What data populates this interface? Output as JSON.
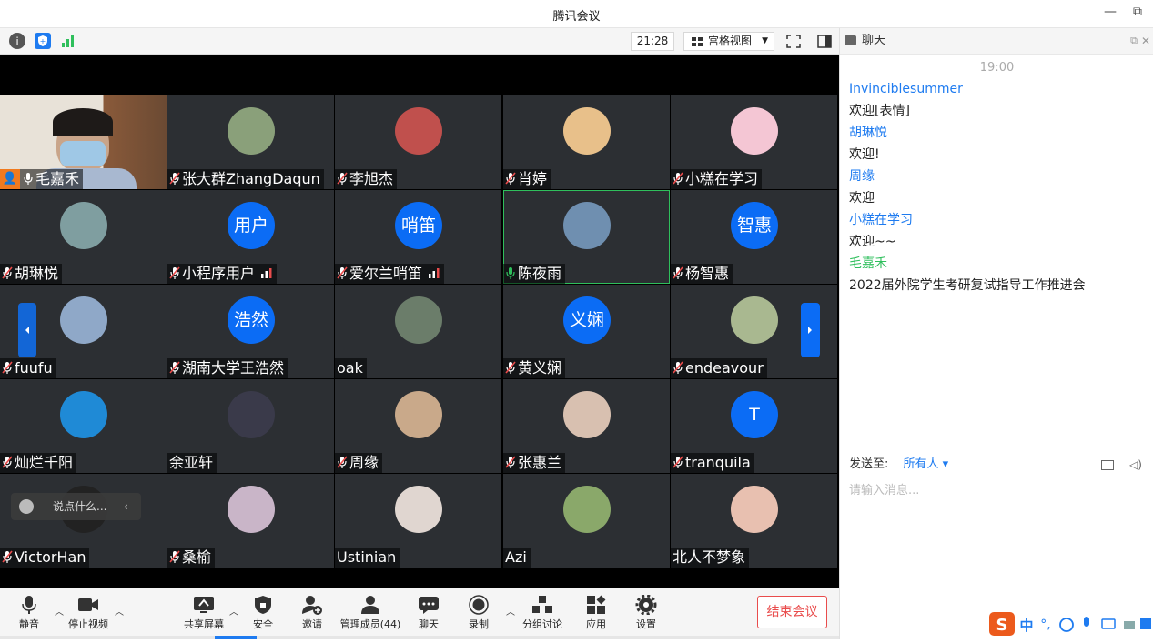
{
  "window": {
    "title": "腾讯会议",
    "minimize_glyph": "—",
    "restore_glyph": "⧉"
  },
  "topbar": {
    "time": "21:28",
    "view_label": "宫格视图"
  },
  "tiles": [
    {
      "name": "毛嘉禾",
      "avatar_text": "",
      "avatar_color": "#7a8a90",
      "video": true
    },
    {
      "name": "张大群ZhangDaqun",
      "avatar_text": "",
      "avatar_color": "#8aa07a"
    },
    {
      "name": "李旭杰",
      "avatar_text": "",
      "avatar_color": "#c0504d"
    },
    {
      "name": "肖婷",
      "avatar_text": "",
      "avatar_color": "#e8c08a"
    },
    {
      "name": "小糕在学习",
      "avatar_text": "",
      "avatar_color": "#f4c6d4"
    },
    {
      "name": "胡琳悦",
      "avatar_text": "",
      "avatar_color": "#7f9ea0"
    },
    {
      "name": "小程序用户",
      "avatar_text": "用户",
      "avatar_color": "#0b6cf5",
      "signal": true
    },
    {
      "name": "爱尔兰哨笛",
      "avatar_text": "哨笛",
      "avatar_color": "#0b6cf5",
      "signal": true
    },
    {
      "name": "陈夜雨",
      "avatar_text": "",
      "avatar_color": "#6f8fb0",
      "speaking": true
    },
    {
      "name": "杨智惠",
      "avatar_text": "智惠",
      "avatar_color": "#0b6cf5"
    },
    {
      "name": "fuufu",
      "avatar_text": "",
      "avatar_color": "#8fa8c8"
    },
    {
      "name": "湖南大学王浩然",
      "avatar_text": "浩然",
      "avatar_color": "#0b6cf5"
    },
    {
      "name": "oak",
      "avatar_text": "",
      "avatar_color": "#6b7d6a",
      "nomic": true
    },
    {
      "name": "黄义娴",
      "avatar_text": "义娴",
      "avatar_color": "#0b6cf5"
    },
    {
      "name": "endeavour",
      "avatar_text": "",
      "avatar_color": "#a9b890"
    },
    {
      "name": "灿烂千阳",
      "avatar_text": "",
      "avatar_color": "#1f8ad6"
    },
    {
      "name": "余亚轩",
      "avatar_text": "",
      "avatar_color": "#3a3a4a",
      "nomic": true
    },
    {
      "name": "周缘",
      "avatar_text": "",
      "avatar_color": "#c9a98a"
    },
    {
      "name": "张惠兰",
      "avatar_text": "",
      "avatar_color": "#d8c0b0"
    },
    {
      "name": "tranquila",
      "avatar_text": "T",
      "avatar_color": "#0b6cf5"
    },
    {
      "name": "VictorHan",
      "avatar_text": "",
      "avatar_color": "#222222"
    },
    {
      "name": "桑榆",
      "avatar_text": "",
      "avatar_color": "#c9b5c8"
    },
    {
      "name": "Ustinian",
      "avatar_text": "",
      "avatar_color": "#e0d6d0",
      "nomic": true
    },
    {
      "name": "Azi",
      "avatar_text": "",
      "avatar_color": "#8aa86a",
      "nomic": true
    },
    {
      "name": "北人不梦象",
      "avatar_text": "",
      "avatar_color": "#e8c0b0",
      "nomic": true
    }
  ],
  "chat_popup": {
    "placeholder": "说点什么..."
  },
  "toolbar": {
    "mute": "静音",
    "stop_video": "停止视频",
    "share": "共享屏幕",
    "security": "安全",
    "invite": "邀请",
    "members": "管理成员(44)",
    "chat": "聊天",
    "record": "录制",
    "breakout": "分组讨论",
    "apps": "应用",
    "settings": "设置",
    "end": "结束会议"
  },
  "chat": {
    "title": "聊天",
    "time": "19:00",
    "messages": [
      {
        "sender": "Invinciblesummer",
        "text": "欢迎[表情]",
        "color": "blue"
      },
      {
        "sender": "胡琳悦",
        "text": "欢迎!",
        "color": "blue"
      },
      {
        "sender": "周缘",
        "text": "欢迎",
        "color": "blue"
      },
      {
        "sender": "小糕在学习",
        "text": "欢迎~~",
        "color": "blue"
      },
      {
        "sender": "毛嘉禾",
        "text": "2022届外院学生考研复试指导工作推进会",
        "color": "green"
      }
    ],
    "send_to_label": "发送至:",
    "send_to_target": "所有人",
    "input_placeholder": "请输入消息..."
  },
  "ime": {
    "lang": "中"
  }
}
